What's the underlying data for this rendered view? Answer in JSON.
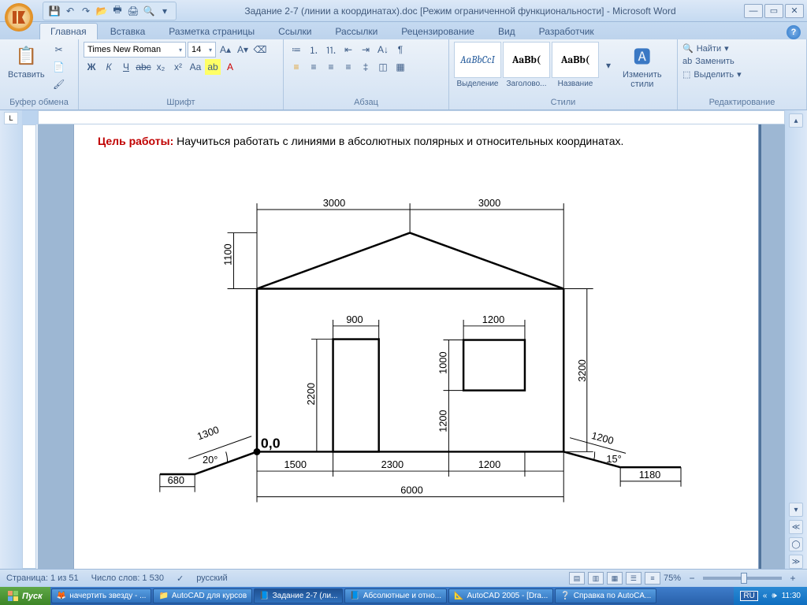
{
  "title": "Задание 2-7 (линии а координатах).doc [Режим ограниченной функциональности] - Microsoft Word",
  "tabs": [
    "Главная",
    "Вставка",
    "Разметка страницы",
    "Ссылки",
    "Рассылки",
    "Рецензирование",
    "Вид",
    "Разработчик"
  ],
  "clipboard": {
    "title": "Буфер обмена",
    "paste": "Вставить"
  },
  "font": {
    "title": "Шрифт",
    "name": "Times New Roman",
    "size": "14"
  },
  "paragraph": {
    "title": "Абзац"
  },
  "styles": {
    "title": "Стили",
    "items": [
      {
        "sample": "AaBbCcI",
        "label": "Выделение",
        "italic": true
      },
      {
        "sample": "AaBb(",
        "label": "Заголово...",
        "bold": true
      },
      {
        "sample": "AaBb(",
        "label": "Название",
        "bold": true
      }
    ],
    "change": "Изменить\nстили"
  },
  "editing": {
    "title": "Редактирование",
    "find": "Найти",
    "replace": "Заменить",
    "select": "Выделить"
  },
  "doc": {
    "goal_label": "Цель работы:",
    "goal_text": "  Научиться  работать  с линиями в  абсолютных полярных и относительных координатах.",
    "origin": "0,0",
    "dims": {
      "top_left": "3000",
      "top_right": "3000",
      "h_roof": "1100",
      "h_wall": "3200",
      "door_w": "900",
      "door_h": "2200",
      "win_w": "1200",
      "win_h": "1000",
      "win_from_floor": "1200",
      "base_1": "1500",
      "base_2": "2300",
      "base_3": "1200",
      "total": "6000",
      "ramp_l_len": "1300",
      "ramp_l_ang": "20°",
      "ramp_l_flat": "680",
      "ramp_r_len": "1200",
      "ramp_r_ang": "15°",
      "ramp_r_flat": "1180"
    }
  },
  "status": {
    "page": "Страница: 1 из 51",
    "words": "Число слов: 1 530",
    "lang": "русский",
    "zoom": "75%"
  },
  "taskbar": {
    "start": "Пуск",
    "items": [
      "начертить звезду - ...",
      "AutoCAD для курсов",
      "Задание 2-7 (ли...",
      "Абсолютные и отно...",
      "AutoCAD 2005 - [Dra...",
      "Справка по AutoCA..."
    ],
    "lang": "RU",
    "time": "11:30"
  }
}
